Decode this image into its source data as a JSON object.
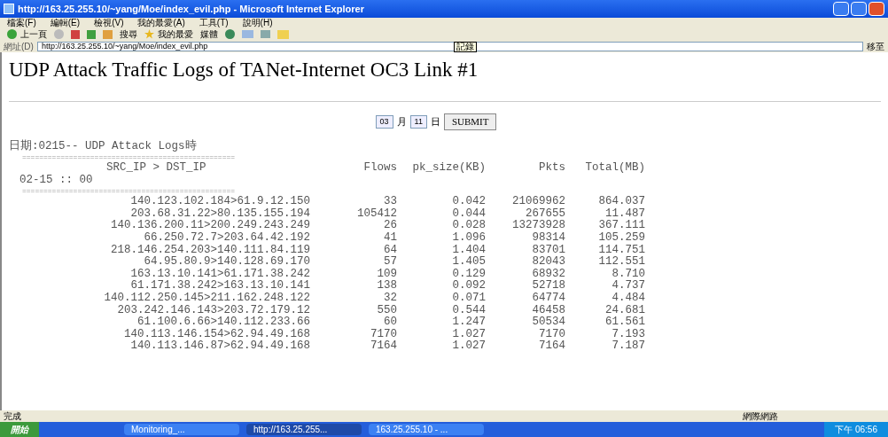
{
  "window": {
    "title": "http://163.25.255.10/~yang/Moe/index_evil.php - Microsoft Internet Explorer"
  },
  "menu": [
    "檔案(F)",
    "編輯(E)",
    "檢視(V)",
    "我的最愛(A)",
    "工具(T)",
    "說明(H)"
  ],
  "toolbar": {
    "back": "上一頁",
    "search": "搜尋",
    "favorites": "我的最愛",
    "media": "媒體"
  },
  "address_bar": {
    "label": "網址(D)",
    "value": "http://163.25.255.10/~yang/Moe/index_evil.php",
    "go": "移至",
    "tooltip": "記錄"
  },
  "page": {
    "heading": "UDP Attack Traffic Logs of TANet-Internet OC3 Link #1",
    "form": {
      "month": "03",
      "month_unit": "月",
      "day": "11",
      "day_unit": "日",
      "submit": "SUBMIT"
    },
    "date_line": "日期:0215-- UDP Attack Logs時",
    "rule": "==================================================",
    "columns": [
      "SRC_IP > DST_IP",
      "Flows",
      "pk_size(KB)",
      "Pkts",
      "Total(MB)"
    ],
    "time_label": "02-15 :: 00",
    "rows": [
      [
        "140.123.102.184>61.9.12.150",
        "33",
        "0.042",
        "21069962",
        "864.037"
      ],
      [
        "203.68.31.22>80.135.155.194",
        "105412",
        "0.044",
        "267655",
        "11.487"
      ],
      [
        "140.136.200.11>200.249.243.249",
        "26",
        "0.028",
        "13273928",
        "367.111"
      ],
      [
        "66.250.72.7>203.64.42.192",
        "41",
        "1.096",
        "98314",
        "105.259"
      ],
      [
        "218.146.254.203>140.111.84.119",
        "64",
        "1.404",
        "83701",
        "114.751"
      ],
      [
        "64.95.80.9>140.128.69.170",
        "57",
        "1.405",
        "82043",
        "112.551"
      ],
      [
        "163.13.10.141>61.171.38.242",
        "109",
        "0.129",
        "68932",
        "8.710"
      ],
      [
        "61.171.38.242>163.13.10.141",
        "138",
        "0.092",
        "52718",
        "4.737"
      ],
      [
        "140.112.250.145>211.162.248.122",
        "32",
        "0.071",
        "64774",
        "4.484"
      ],
      [
        "203.242.146.143>203.72.179.12",
        "550",
        "0.544",
        "46458",
        "24.681"
      ],
      [
        "61.100.6.66>140.112.233.66",
        "60",
        "1.247",
        "50534",
        "61.561"
      ],
      [
        "140.113.146.154>62.94.49.168",
        "7170",
        "1.027",
        "7170",
        "7.193"
      ],
      [
        "140.113.146.87>62.94.49.168",
        "7164",
        "1.027",
        "7164",
        "7.187"
      ]
    ]
  },
  "status_bar": {
    "text": "完成",
    "zone": "網際網路"
  },
  "taskbar": {
    "start": "開始",
    "tasks": [
      {
        "label": "Monitoring_...",
        "selected": false
      },
      {
        "label": "http://163.25.255...",
        "selected": true
      },
      {
        "label": "163.25.255.10 - ...",
        "selected": false
      }
    ],
    "clock": "下午 06:56"
  }
}
